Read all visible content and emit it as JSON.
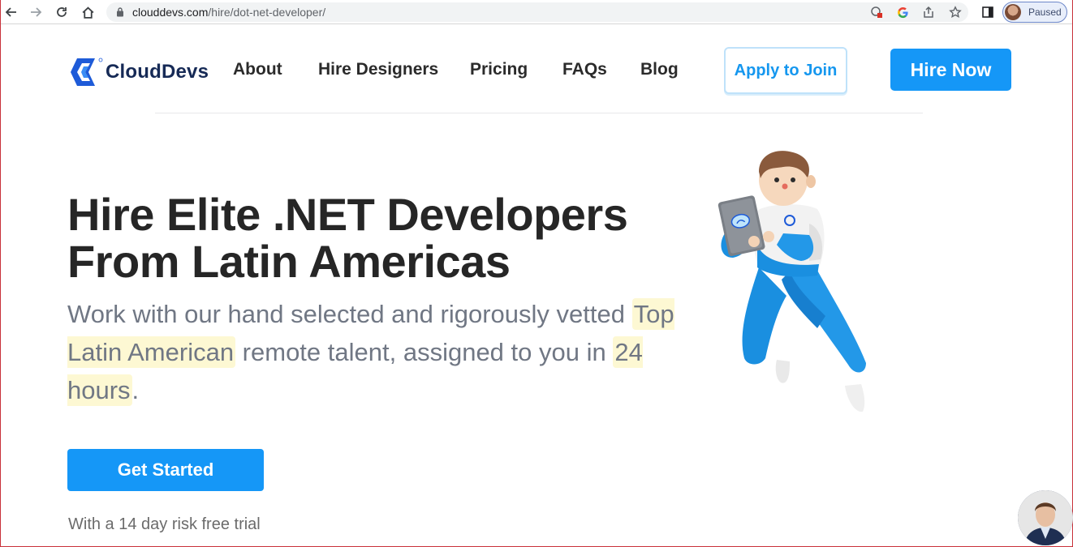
{
  "browser": {
    "url_host": "clouddevs.com",
    "url_path": "/hire/dot-net-developer/",
    "profile_status": "Paused"
  },
  "header": {
    "logo_text": "CloudDevs",
    "nav": [
      "About",
      "Hire Designers",
      "Pricing",
      "FAQs",
      "Blog"
    ],
    "apply_label": "Apply to Join",
    "hire_label": "Hire Now"
  },
  "hero": {
    "title_line1": "Hire Elite .NET Developers",
    "title_line2": "From Latin Americas",
    "sub_part1": "Work with our hand selected and rigorously vetted ",
    "sub_highlight1": "Top Latin American",
    "sub_part2": " remote talent, assigned to you in ",
    "sub_highlight2": "24 hours",
    "sub_part3": ".",
    "cta_label": "Get Started",
    "trial_note": "With a 14 day risk free trial"
  },
  "colors": {
    "brand_blue": "#1597f7",
    "navy": "#162a56",
    "highlight": "#fdf8d3"
  },
  "icons": [
    "back-icon",
    "forward-icon",
    "reload-icon",
    "home-icon",
    "lock-icon",
    "extension-icon",
    "google-icon",
    "share-icon",
    "star-icon",
    "sidepanel-icon"
  ]
}
